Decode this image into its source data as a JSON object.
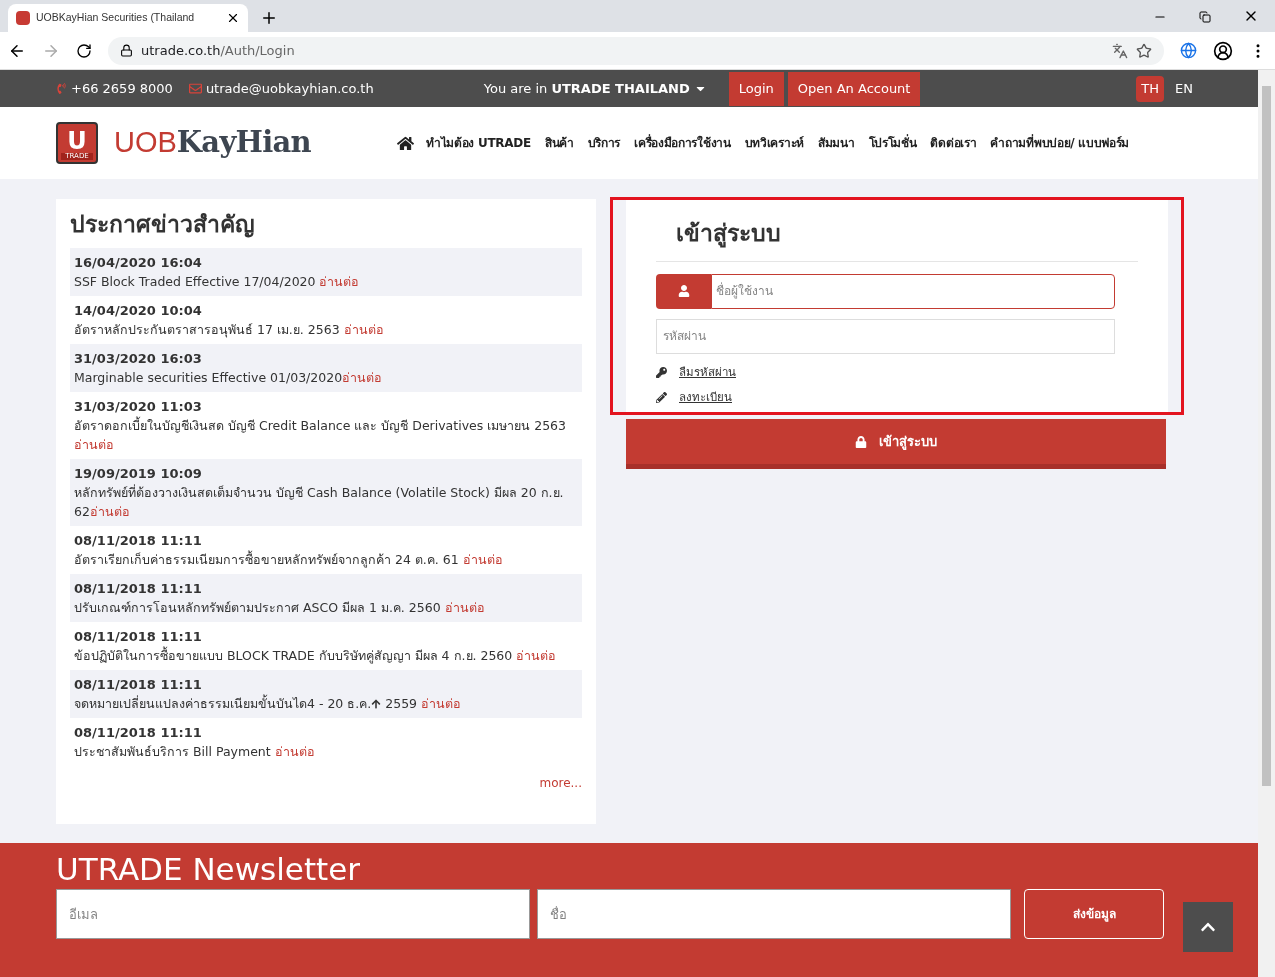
{
  "browser": {
    "tab_title": "UOBKayHian Securities (Thailand",
    "url_host": "utrade.co.th",
    "url_path": "/Auth/Login"
  },
  "topbar": {
    "phone": "+66 2659 8000",
    "email": "utrade@uobkayhian.co.th",
    "region_prefix": "You are in",
    "region": "UTRADE THAILAND",
    "login": "Login",
    "open_account": "Open An Account",
    "languages": [
      {
        "label": "TH",
        "selected": true
      },
      {
        "label": "EN",
        "selected": false
      }
    ]
  },
  "header": {
    "logo_letter": "U",
    "logo_badge": "TRADE",
    "logo_part1": "UOB",
    "logo_part2": "KayHian",
    "nav": [
      "ทำไมต้อง UTRADE",
      "สินค้า",
      "บริการ",
      "เครื่องมือการใช้งาน",
      "บทวิเคราะห์",
      "สัมมนา",
      "โปรโมชั่น",
      "ติดต่อเรา",
      "คำถามที่พบบ่อย/ แบบฟอร์ม"
    ]
  },
  "news": {
    "title": "ประกาศข่าวสำคัญ",
    "more": "more...",
    "items": [
      {
        "date": "16/04/2020 16:04",
        "text": "SSF Block Traded Effective 17/04/2020 ",
        "link": "อ่านต่อ"
      },
      {
        "date": "14/04/2020 10:04",
        "text": "อัตราหลักประกันตราสารอนุพันธ์ 17 เม.ย. 2563 ",
        "link": "อ่านต่อ"
      },
      {
        "date": "31/03/2020 16:03",
        "text": "Marginable securities Effective 01/03/2020",
        "link": "อ่านต่อ"
      },
      {
        "date": "31/03/2020 11:03",
        "text": "อัตราดอกเบี้ยในบัญชีเงินสด บัญชี Credit Balance และ บัญชี Derivatives เมษายน 2563 ",
        "link": "อ่านต่อ"
      },
      {
        "date": "19/09/2019 10:09",
        "text": "หลักทรัพย์ที่ต้องวางเงินสดเต็มจำนวน บัญชี Cash Balance (Volatile Stock) มีผล 20 ก.ย. 62",
        "link": "อ่านต่อ"
      },
      {
        "date": "08/11/2018 11:11",
        "text": "อัตราเรียกเก็บค่าธรรมเนียมการซื้อขายหลักทรัพย์จากลูกค้า 24 ต.ค. 61 ",
        "link": "อ่านต่อ"
      },
      {
        "date": "08/11/2018 11:11",
        "text": "ปรับเกณฑ์การโอนหลักทรัพย์ตามประกาศ ASCO มีผล 1 ม.ค. 2560 ",
        "link": "อ่านต่อ"
      },
      {
        "date": "08/11/2018 11:11",
        "text": "ข้อปฏิบัติในการซื้อขายแบบ BLOCK TRADE กับบริษัทคู่สัญญา มีผล 4 ก.ย. 2560 ",
        "link": "อ่านต่อ"
      },
      {
        "date": "08/11/2018 11:11",
        "text": "จดหมายเปลี่ยนแปลงค่าธรรมเนียมขั้นบันได4 - 20 ธ.ค.",
        "text_after": " 2559 ",
        "link": "อ่านต่อ"
      },
      {
        "date": "08/11/2018 11:11",
        "text": "ประชาสัมพันธ์บริการ Bill Payment ",
        "link": "อ่านต่อ"
      }
    ]
  },
  "login": {
    "title": "เข้าสู่ระบบ",
    "username_placeholder": "ชื่อผู้ใช้งาน",
    "password_placeholder": "รหัสผ่าน",
    "forgot": "ลืมรหัสผ่าน",
    "register": "ลงทะเบียน",
    "submit": "เข้าสู่ระบบ"
  },
  "newsletter": {
    "title": "UTRADE Newsletter",
    "email_placeholder": "อีเมล",
    "name_placeholder": "ชื่อ",
    "submit": "ส่งข้อมูล"
  }
}
